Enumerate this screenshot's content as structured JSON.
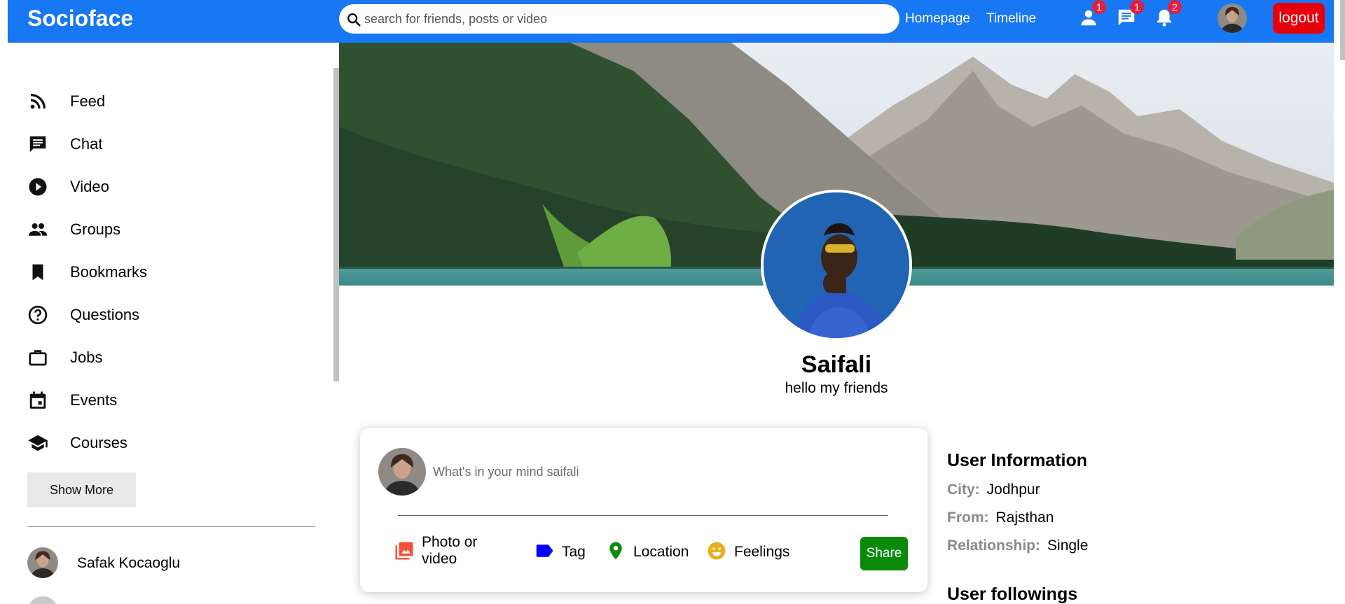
{
  "app": {
    "name": "Socioface"
  },
  "search": {
    "placeholder": "search for friends, posts or video"
  },
  "nav": {
    "homepage": "Homepage",
    "timeline": "Timeline"
  },
  "badges": {
    "friends": "1",
    "messages": "1",
    "notifications": "2"
  },
  "logout_label": "logout",
  "sidebar": {
    "items": [
      {
        "label": "Feed",
        "icon": "rss-feed-icon"
      },
      {
        "label": "Chat",
        "icon": "chat-icon"
      },
      {
        "label": "Video",
        "icon": "play-circle-icon"
      },
      {
        "label": "Groups",
        "icon": "groups-icon"
      },
      {
        "label": "Bookmarks",
        "icon": "bookmark-icon"
      },
      {
        "label": "Questions",
        "icon": "help-circle-icon"
      },
      {
        "label": "Jobs",
        "icon": "briefcase-icon"
      },
      {
        "label": "Events",
        "icon": "calendar-icon"
      },
      {
        "label": "Courses",
        "icon": "school-icon"
      }
    ],
    "show_more": "Show More",
    "friends": [
      {
        "name": "Safak Kocaoglu"
      }
    ]
  },
  "profile": {
    "name": "Saifali",
    "description": "hello my friends"
  },
  "share": {
    "placeholder": "What's in your mind saifali",
    "options": {
      "photo": "Photo or video",
      "tag": "Tag",
      "location": "Location",
      "feelings": "Feelings"
    },
    "button": "Share"
  },
  "user_info": {
    "title": "User Information",
    "city_label": "City:",
    "city": "Jodhpur",
    "from_label": "From:",
    "from": "Rajsthan",
    "relationship_label": "Relationship:",
    "relationship": "Single"
  },
  "followings_title": "User followings",
  "colors": {
    "brand": "#1877f2",
    "logout": "#e5000b",
    "share": "#0a8a0a",
    "badge": "#e41e3f"
  }
}
